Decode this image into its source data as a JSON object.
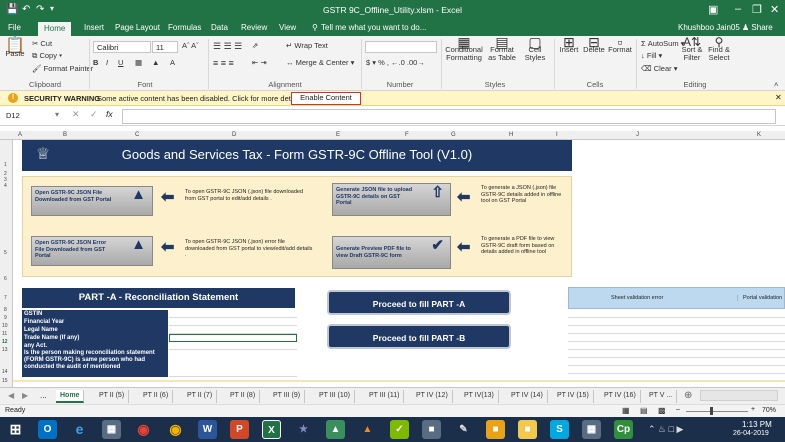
{
  "window": {
    "title": "GSTR 9C_Offline_Utility.xlsm - Excel",
    "user": "Khushboo Jain05",
    "share_label": "Share"
  },
  "ribbon_tabs": [
    "File",
    "Home",
    "Insert",
    "Page Layout",
    "Formulas",
    "Data",
    "Review",
    "View"
  ],
  "tell_me": "Tell me what you want to do...",
  "ribbon": {
    "clipboard": {
      "paste": "Paste",
      "cut": "Cut",
      "copy": "Copy",
      "format_painter": "Format Painter",
      "label": "Clipboard"
    },
    "font": {
      "name": "Calibri",
      "size": "11",
      "label": "Font"
    },
    "alignment": {
      "wrap": "Wrap Text",
      "merge": "Merge & Center",
      "label": "Alignment"
    },
    "number": {
      "label": "Number"
    },
    "styles": {
      "conditional": "Conditional Formatting",
      "format_table": "Format as Table",
      "cell_styles": "Cell Styles",
      "label": "Styles"
    },
    "cells": {
      "insert": "Insert",
      "delete": "Delete",
      "format": "Format",
      "label": "Cells"
    },
    "editing": {
      "autosum": "AutoSum",
      "fill": "Fill",
      "clear": "Clear",
      "sort": "Sort & Filter",
      "find": "Find & Select",
      "label": "Editing"
    }
  },
  "security_bar": {
    "title": "SECURITY WARNING",
    "message": "Some active content has been disabled. Click for more details.",
    "button": "Enable Content"
  },
  "formula_bar": {
    "name_box": "D12",
    "fx": "fx",
    "content": ""
  },
  "columns": [
    "A",
    "B",
    "C",
    "D",
    "E",
    "F",
    "G",
    "H",
    "I",
    "J",
    "K"
  ],
  "rows": [
    "1",
    "2",
    "3",
    "4",
    "5",
    "6",
    "7",
    "8",
    "9",
    "10",
    "11",
    "12",
    "13",
    "14",
    "15"
  ],
  "sheet": {
    "title": "Goods and Services Tax - Form GSTR-9C Offline Tool (V1.0)",
    "buttons": [
      {
        "label": "Open GSTR-9C JSON File Downloaded from GST Portal",
        "desc": "To open GSTR-9C JSON (.json) file downloaded from GST portal to edit/add details ."
      },
      {
        "label": "Open GSTR-9C JSON Error File Downloaded from GST Portal",
        "desc": "To open GSTR-9C JSON (.json) error file downloaded from GST portal to view/edit/add details ."
      },
      {
        "label": "Generate JSON file to upload GSTR-9C details on GST Portal",
        "desc": "To generate a JSON (.json) file GSTR-9C details added in offline tool on GST Portal"
      },
      {
        "label": "Generate Preview PDF file to view Draft GSTR-9C form",
        "desc": "To generate a PDF file to view GSTR-9C draft form based on details added in offline tool"
      }
    ],
    "part_a_title": "PART -A - Reconciliation Statement",
    "fields": [
      "GSTIN",
      "Financial Year",
      "Legal Name",
      "Trade Name (If any)",
      "any Act.",
      "Is the person making reconciliation statement (FORM GSTR-9C) is same person who had conducted the audit of mentioned"
    ],
    "proceed_a": "Proceed to fill PART -A",
    "proceed_b": "Proceed to fill PART -B",
    "validation_headers": [
      "Sheet validation error",
      "Portal validation"
    ]
  },
  "sheet_tabs": [
    "Home",
    "PT II (5)",
    "PT II (6)",
    "PT II (7)",
    "PT II (8)",
    "PT III (9)",
    "PT III (10)",
    "PT III (11)",
    "PT IV (12)",
    "PT IV(13)",
    "PT IV (14)",
    "PT IV (15)",
    "PT IV (16)",
    "PT V ..."
  ],
  "status": {
    "ready": "Ready",
    "zoom": "70%"
  },
  "taskbar": {
    "time": "1:13 PM",
    "date": "26-04-2019"
  },
  "colors": {
    "excel_green": "#217346",
    "navy": "#1f3864",
    "panel": "#fdf0cc"
  }
}
